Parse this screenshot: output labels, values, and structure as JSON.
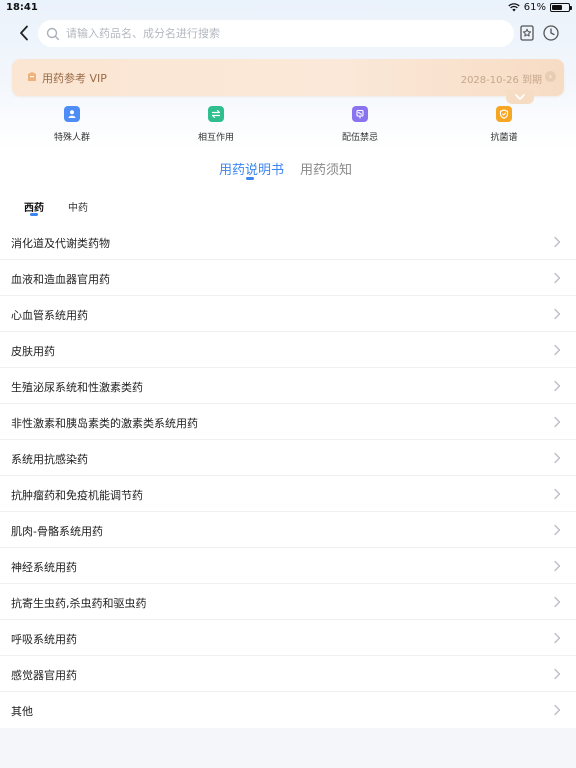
{
  "status_bar": {
    "time": "18:41",
    "battery": "61%",
    "battery_level": 0.61
  },
  "search": {
    "placeholder": "请输入药品名、成分名进行搜索",
    "value": ""
  },
  "vip": {
    "title": "用药参考 VIP",
    "expiry": "2028-10-26 到期"
  },
  "tools": [
    {
      "label": "特殊人群",
      "icon": "person-badge-icon",
      "color": "#4e8df5"
    },
    {
      "label": "相互作用",
      "icon": "swap-arrows-icon",
      "color": "#2fbf8f"
    },
    {
      "label": "配伍禁忌",
      "icon": "incompatibility-icon",
      "color": "#8b73ef"
    },
    {
      "label": "抗菌谱",
      "icon": "shield-icon",
      "color": "#f5a623"
    }
  ],
  "main_tabs": [
    {
      "label": "用药说明书",
      "active": true
    },
    {
      "label": "用药须知",
      "active": false
    }
  ],
  "sub_tabs": [
    {
      "label": "西药",
      "active": true
    },
    {
      "label": "中药",
      "active": false
    }
  ],
  "categories": [
    "消化道及代谢类药物",
    "血液和造血器官用药",
    "心血管系统用药",
    "皮肤用药",
    "生殖泌尿系统和性激素类药",
    "非性激素和胰岛素类的激素类系统用药",
    "系统用抗感染药",
    "抗肿瘤药和免疫机能调节药",
    "肌肉-骨骼系统用药",
    "神经系统用药",
    "抗寄生虫药,杀虫药和驱虫药",
    "呼吸系统用药",
    "感觉器官用药",
    "其他"
  ],
  "colors": {
    "accent": "#3b86f0",
    "vip_text": "#9a6a46"
  }
}
